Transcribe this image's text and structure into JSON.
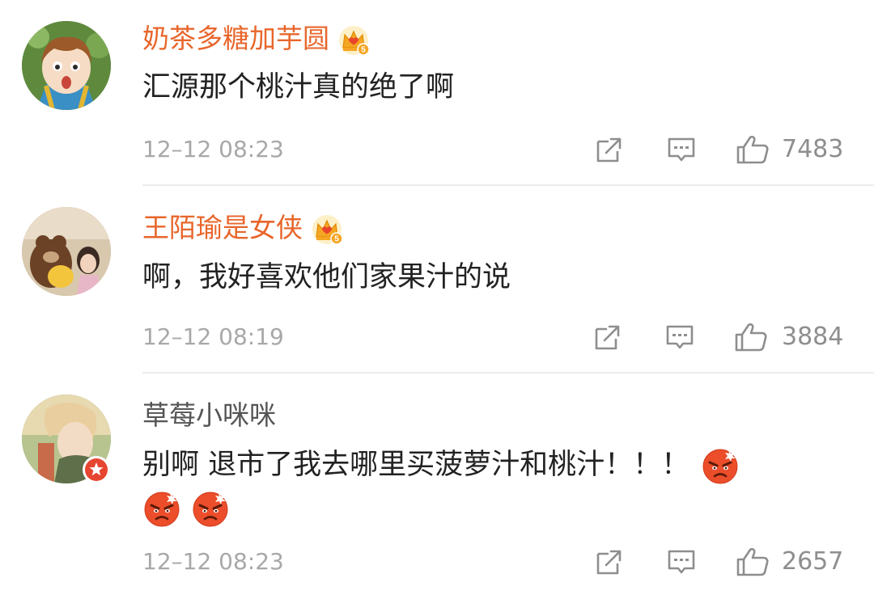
{
  "comments": [
    {
      "username": "奶茶多糖加芋圆",
      "user_type": "vip",
      "badge_icon": "crown-level-5-icon",
      "text": "汇源那个桃汁真的绝了啊",
      "time": "12–12 08:23",
      "likes": "7483"
    },
    {
      "username": "王陌瑜是女侠",
      "user_type": "vip",
      "badge_icon": "crown-level-5-icon",
      "text": "啊，我好喜欢他们家果汁的说",
      "time": "12–12 08:19",
      "likes": "3884"
    },
    {
      "username": "草莓小咪咪",
      "user_type": "normal",
      "badge_icon": "verified-star-badge-icon",
      "text": "别啊 退市了我去哪里买菠萝汁和桃汁！！！",
      "emojis": [
        "angry-face-icon",
        "angry-face-icon",
        "angry-face-icon"
      ],
      "time": "12–12 08:23",
      "likes": "2657"
    }
  ],
  "icons": {
    "share": "share-icon",
    "comment": "comment-icon",
    "like": "thumbs-up-icon"
  },
  "colors": {
    "vip_name": "#e8662b",
    "normal_name": "#555555",
    "text": "#222222",
    "meta": "#a8a8a8",
    "divider": "#ececec",
    "emoji": "#e8452b"
  }
}
